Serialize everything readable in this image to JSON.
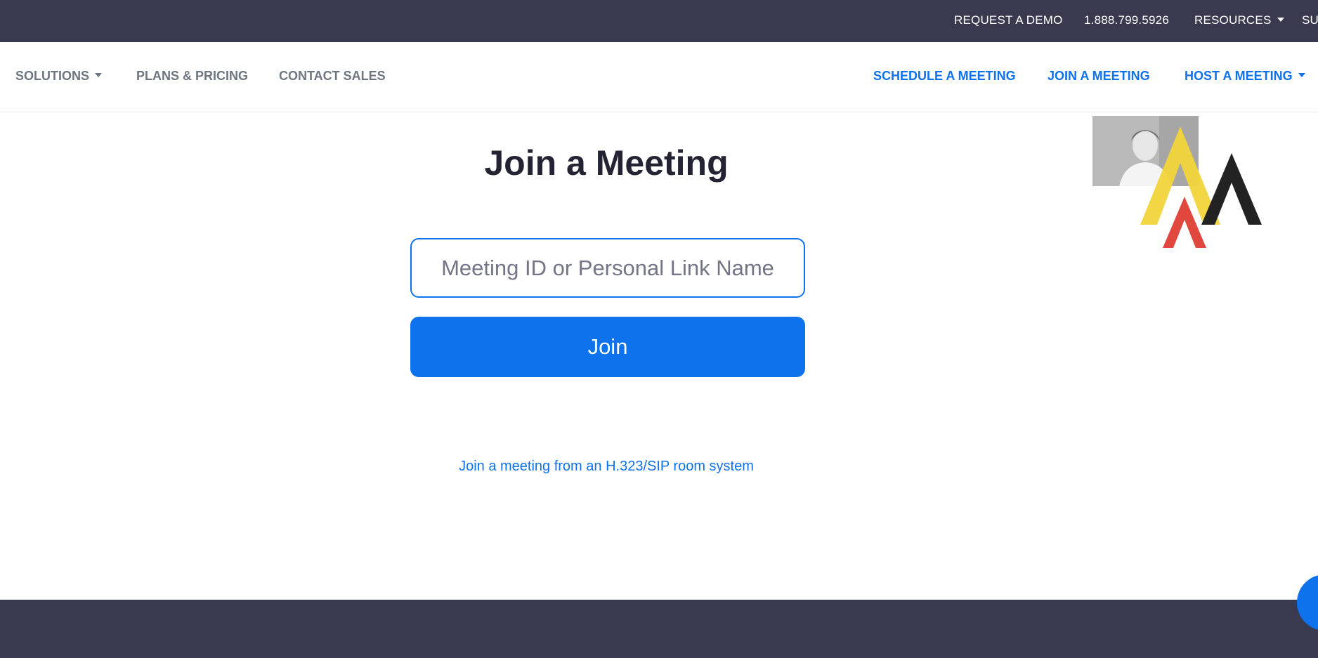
{
  "topbar": {
    "request_demo": "REQUEST A DEMO",
    "phone": "1.888.799.5926",
    "resources": "RESOURCES",
    "support_partial": "SU"
  },
  "navbar": {
    "solutions": "SOLUTIONS",
    "plans_pricing": "PLANS & PRICING",
    "contact_sales": "CONTACT SALES",
    "schedule_meeting": "SCHEDULE A MEETING",
    "join_meeting": "JOIN A MEETING",
    "host_meeting": "HOST A MEETING"
  },
  "main": {
    "title": "Join a Meeting",
    "meeting_input": {
      "placeholder": "Meeting ID or Personal Link Name",
      "value": ""
    },
    "join_label": "Join",
    "sip_link": "Join a meeting from an H.323/SIP room system"
  },
  "overlay": {
    "logo_letters": [
      "A",
      "A",
      "A"
    ]
  },
  "colors": {
    "topbar_bg": "#393a4f",
    "accent_blue": "#0e72ed",
    "nav_gray": "#6e7680",
    "title_dark": "#232333",
    "logo_yellow": "#f2d43a",
    "logo_red": "#e0483e",
    "logo_black": "#222222"
  }
}
